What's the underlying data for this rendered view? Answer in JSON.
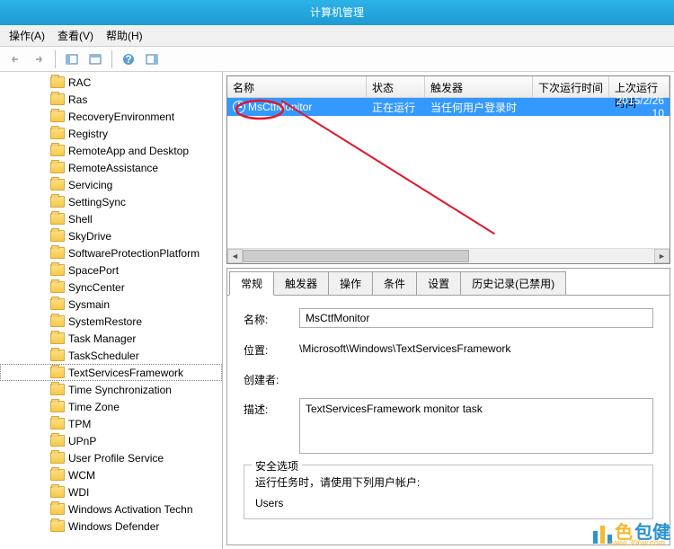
{
  "window": {
    "title": "计算机管理"
  },
  "menu": {
    "action": "操作(A)",
    "view": "查看(V)",
    "help": "帮助(H)"
  },
  "tree": {
    "items": [
      "RAC",
      "Ras",
      "RecoveryEnvironment",
      "Registry",
      "RemoteApp and Desktop",
      "RemoteAssistance",
      "Servicing",
      "SettingSync",
      "Shell",
      "SkyDrive",
      "SoftwareProtectionPlatform",
      "SpacePort",
      "SyncCenter",
      "Sysmain",
      "SystemRestore",
      "Task Manager",
      "TaskScheduler",
      "TextServicesFramework",
      "Time Synchronization",
      "Time Zone",
      "TPM",
      "UPnP",
      "User Profile Service",
      "WCM",
      "WDI",
      "Windows Activation Techn",
      "Windows Defender"
    ],
    "selectedIndex": 17
  },
  "list": {
    "headers": {
      "name": "名称",
      "status": "状态",
      "trigger": "触发器",
      "next": "下次运行时间",
      "last": "上次运行时间"
    },
    "row": {
      "name": "MsCtfMonitor",
      "status": "正在运行",
      "trigger": "当任何用户登录时",
      "next": "",
      "last": "2015/2/26 10"
    }
  },
  "tabs": {
    "general": "常规",
    "triggers": "触发器",
    "actions": "操作",
    "conditions": "条件",
    "settings": "设置",
    "history": "历史记录(已禁用)"
  },
  "detail": {
    "labels": {
      "name": "名称:",
      "location": "位置:",
      "author": "创建者:",
      "description": "描述:"
    },
    "name": "MsCtfMonitor",
    "location": "\\Microsoft\\Windows\\TextServicesFramework",
    "author": "",
    "description": "TextServicesFramework monitor task",
    "security": {
      "legend": "安全选项",
      "note": "运行任务时，请使用下列用户帐户:",
      "account": "Users"
    }
  },
  "watermark": {
    "text1": "色",
    "text2": "包健",
    "sub": "www.306w.com"
  }
}
